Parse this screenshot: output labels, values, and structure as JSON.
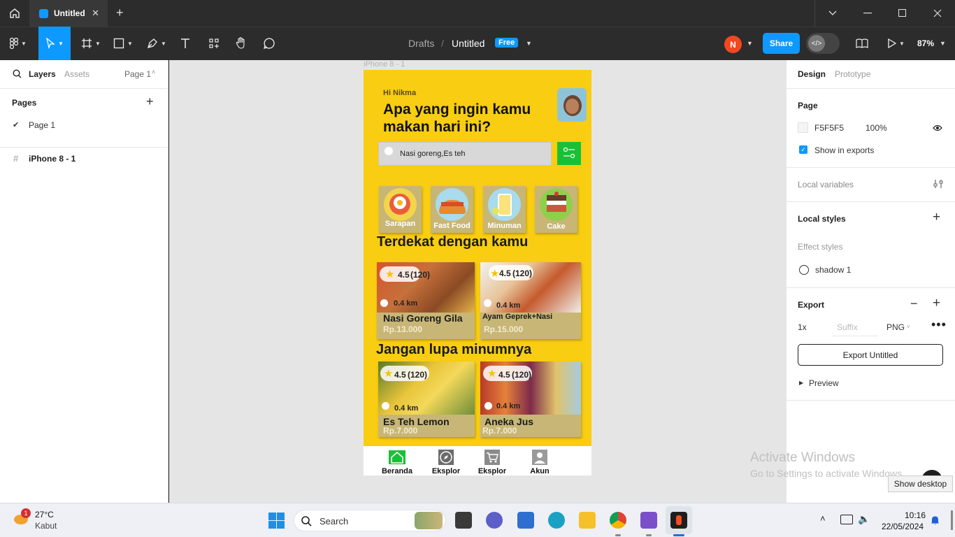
{
  "window": {
    "tab_title": "Untitled"
  },
  "toolbar": {
    "breadcrumb_parent": "Drafts",
    "breadcrumb_sep": "/",
    "file_name": "Untitled",
    "plan_badge": "Free",
    "user_initial": "N",
    "share_label": "Share",
    "zoom": "87%"
  },
  "left_panel": {
    "tabs": [
      "Layers",
      "Assets"
    ],
    "page_selector": "Page 1",
    "pages_heading": "Pages",
    "pages": [
      "Page 1"
    ],
    "layers": [
      "iPhone 8 - 1"
    ]
  },
  "canvas": {
    "frame_label": "iPhone 8 - 1",
    "app": {
      "greeting": "Hi Nikma",
      "headline_1": "Apa yang ingin kamu",
      "headline_2": "makan hari ini?",
      "search_value": "Nasi goreng,Es teh",
      "categories": [
        "Sarapan",
        "Fast Food",
        "Minuman",
        "Cake"
      ],
      "section_nearby": "Terdekat dengan kamu",
      "section_drinks": "Jangan lupa minumnya",
      "foods": [
        {
          "rating": "4.5",
          "count": "(120)",
          "distance": "0.4 km",
          "name": "Nasi Goreng Gila",
          "price": "Rp.13.000"
        },
        {
          "rating": "4.5",
          "count": "(120)",
          "distance": "0.4 km",
          "name": "Ayam Geprek+Nasi",
          "price": "Rp.15.000"
        }
      ],
      "drinks": [
        {
          "rating": "4.5",
          "count": "(120)",
          "distance": "0.4 km",
          "name": "Es Teh Lemon",
          "price": "Rp.7.000"
        },
        {
          "rating": "4.5",
          "count": "(120)",
          "distance": "0.4 km",
          "name": "Aneka Jus",
          "price": "Rp.7.000"
        }
      ],
      "nav": [
        "Beranda",
        "Eksplor",
        "Eksplor",
        "Akun"
      ]
    }
  },
  "right_panel": {
    "tabs": [
      "Design",
      "Prototype"
    ],
    "page_heading": "Page",
    "page_color": "F5F5F5",
    "page_opacity": "100%",
    "show_in_exports": "Show in exports",
    "local_variables": "Local variables",
    "local_styles": "Local styles",
    "effect_styles": "Effect styles",
    "effect_item": "shadow 1",
    "export_heading": "Export",
    "export_scale": "1x",
    "export_suffix_placeholder": "Suffix",
    "export_format": "PNG",
    "export_button": "Export Untitled",
    "preview": "Preview"
  },
  "watermark": {
    "line1": "Activate Windows",
    "line2": "Go to Settings to activate Windows."
  },
  "tooltip": "Show desktop",
  "taskbar": {
    "weather_badge": "1",
    "temp": "27°C",
    "condition": "Kabut",
    "search_placeholder": "Search",
    "time": "10:16",
    "date": "22/05/2024"
  },
  "colors": {
    "figma_blue": "#0d99ff",
    "app_yellow": "#f9cd11",
    "card_tan": "#c8b676",
    "filter_green": "#19c037"
  }
}
